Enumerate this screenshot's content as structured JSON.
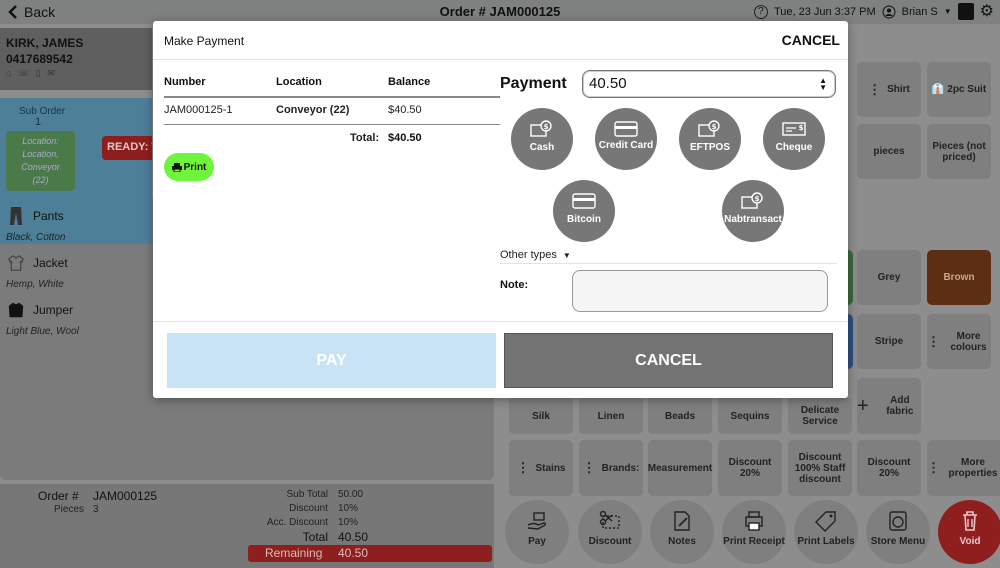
{
  "topbar": {
    "back_label": "Back",
    "order_title": "Order # JAM000125",
    "help_icon": "?",
    "datetime": "Tue, 23 Jun 3:37 PM",
    "user": "Brian S"
  },
  "customer": {
    "name": "KIRK, JAMES",
    "phone": "0417689542",
    "icons": [
      "home-icon",
      "phone-icon",
      "mobile-icon",
      "mail-icon"
    ]
  },
  "suborder": {
    "label": "Sub Order",
    "number": "1",
    "location_lines": [
      "Location:",
      "Location,",
      "Conveyor",
      "(22)"
    ],
    "status": "READY: W"
  },
  "garments": [
    {
      "name": "Pants",
      "details": "Black, Cotton",
      "selected": true
    },
    {
      "name": "Jacket",
      "details": "Hemp, White",
      "selected": false
    },
    {
      "name": "Jumper",
      "details": "Light Blue, Wool",
      "selected": false
    }
  ],
  "summary": {
    "order_label": "Order #",
    "order_number": "JAM000125",
    "pieces_label": "Pieces",
    "pieces": "3",
    "sub_total_label": "Sub Total",
    "sub_total": "50.00",
    "discount_label": "Discount",
    "discount": "10%",
    "acc_discount_label": "Acc. Discount",
    "acc_discount": "10%",
    "total_label": "Total",
    "total": "40.50",
    "remaining_label": "Remaining",
    "remaining": "40.50"
  },
  "right_tiles": {
    "shirt": "Shirt",
    "two_pc_suit": "2pc Suit",
    "pieces": "pieces",
    "pieces_not_priced": "Pieces (not priced)",
    "grey": "Grey",
    "brown": "Brown",
    "stripe": "Stripe",
    "more_colours": "More colours",
    "silk": "Silk",
    "linen": "Linen",
    "beads": "Beads",
    "sequins": "Sequins",
    "delicate_service": "Delicate Service",
    "add_fabric": "Add fabric",
    "stains": "Stains",
    "brands": "Brands:",
    "measurement": "Measurement",
    "discount20_a": "Discount 20%",
    "discount_staff": "Discount 100% Staff discount",
    "discount20_b": "Discount 20%",
    "more_properties": "More properties"
  },
  "bottom_actions": {
    "pay": "Pay",
    "discount": "Discount",
    "notes": "Notes",
    "print_receipt": "Print Receipt",
    "print_labels": "Print Labels",
    "store_menu": "Store Menu",
    "void": "Void"
  },
  "modal": {
    "title": "Make Payment",
    "cancel_top": "CANCEL",
    "table": {
      "headers": [
        "Number",
        "Location",
        "Balance"
      ],
      "rows": [
        {
          "number": "JAM000125-1",
          "location": "Conveyor (22)",
          "balance": "$40.50"
        }
      ],
      "total_label": "Total:",
      "total_value": "$40.50"
    },
    "print_label": "Print",
    "payment_label": "Payment",
    "payment_value": "40.50",
    "methods": {
      "cash": "Cash",
      "credit_card": "Credit Card",
      "eftpos": "EFTPOS",
      "cheque": "Cheque",
      "bitcoin": "Bitcoin",
      "nabtransact": "Nabtransact"
    },
    "other_types": "Other types",
    "note_label": "Note:",
    "note_value": "",
    "pay_button": "PAY",
    "cancel_button": "CANCEL"
  },
  "colors": {
    "accent_blue": "#4e7f99",
    "ready_red": "#8f1f1f",
    "print_green": "#6ef53b",
    "pay_disabled": "#c7e3f4",
    "cancel_grey": "#737373"
  }
}
